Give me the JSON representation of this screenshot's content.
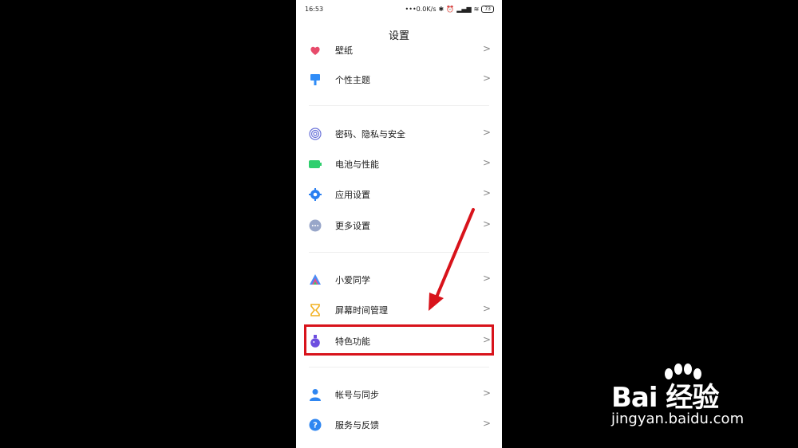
{
  "status": {
    "time": "16:53",
    "net": "•••0.0K/s",
    "battery": "73"
  },
  "header": {
    "title": "设置"
  },
  "items": [
    {
      "label": "壁纸",
      "icon": "wallpaper-icon",
      "color": "#e74b6b"
    },
    {
      "label": "个性主题",
      "icon": "theme-brush-icon",
      "color": "#2f8cf7"
    },
    {
      "label": "密码、隐私与安全",
      "icon": "fingerprint-icon",
      "color": "#6b74d9"
    },
    {
      "label": "电池与性能",
      "icon": "battery-icon",
      "color": "#2fcf6e"
    },
    {
      "label": "应用设置",
      "icon": "gear-icon",
      "color": "#2a7ff1"
    },
    {
      "label": "更多设置",
      "icon": "more-dots-icon",
      "color": "#98a6c9"
    },
    {
      "label": "小爱同学",
      "icon": "xiaoai-icon",
      "color": "#4c8bf5"
    },
    {
      "label": "屏幕时间管理",
      "icon": "hourglass-icon",
      "color": "#f2b01e"
    },
    {
      "label": "特色功能",
      "icon": "flask-icon",
      "color": "#6d4ee0"
    },
    {
      "label": "帐号与同步",
      "icon": "person-icon",
      "color": "#2f86f1"
    },
    {
      "label": "服务与反馈",
      "icon": "help-icon",
      "color": "#2f86f1"
    }
  ],
  "chevron": ">",
  "annotation": {
    "highlight_color": "#d8131b"
  },
  "watermark": {
    "brand": "Bai 经验",
    "url": "jingyan.baidu.com"
  }
}
